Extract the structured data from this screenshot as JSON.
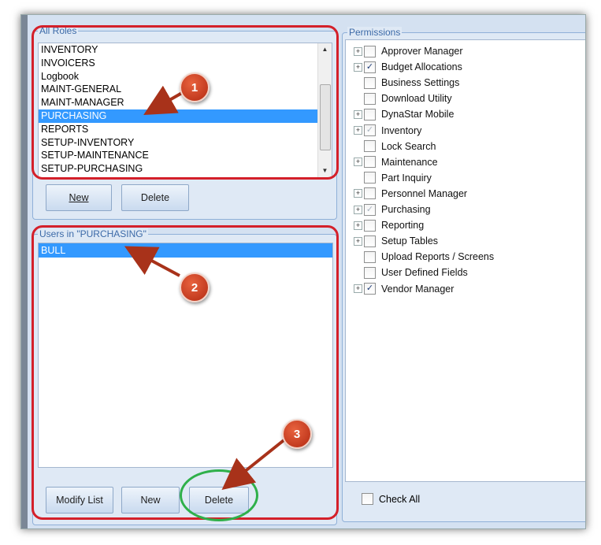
{
  "roles_panel": {
    "legend": "All Roles",
    "items": [
      "INVENTORY",
      "INVOICERS",
      "Logbook",
      "MAINT-GENERAL",
      "MAINT-MANAGER",
      "PURCHASING",
      "REPORTS",
      "SETUP-INVENTORY",
      "SETUP-MAINTENANCE",
      "SETUP-PURCHASING"
    ],
    "selected": "PURCHASING",
    "new_button": "New",
    "delete_button": "Delete"
  },
  "users_panel": {
    "legend": "Users in \"PURCHASING\"",
    "items": [
      "BULL"
    ],
    "modify_button": "Modify List",
    "new_button": "New",
    "delete_button": "Delete"
  },
  "permissions_panel": {
    "legend": "Permissions",
    "items": [
      {
        "label": "Approver Manager",
        "expandable": true,
        "state": "unchecked"
      },
      {
        "label": "Budget Allocations",
        "expandable": true,
        "state": "checked"
      },
      {
        "label": "Business Settings",
        "expandable": false,
        "state": "unchecked"
      },
      {
        "label": "Download Utility",
        "expandable": false,
        "state": "unchecked"
      },
      {
        "label": "DynaStar Mobile",
        "expandable": true,
        "state": "unchecked"
      },
      {
        "label": "Inventory",
        "expandable": true,
        "state": "partial"
      },
      {
        "label": "Lock Search",
        "expandable": false,
        "state": "unchecked"
      },
      {
        "label": "Maintenance",
        "expandable": true,
        "state": "unchecked"
      },
      {
        "label": "Part Inquiry",
        "expandable": false,
        "state": "unchecked"
      },
      {
        "label": "Personnel Manager",
        "expandable": true,
        "state": "unchecked"
      },
      {
        "label": "Purchasing",
        "expandable": true,
        "state": "partial"
      },
      {
        "label": "Reporting",
        "expandable": true,
        "state": "unchecked"
      },
      {
        "label": "Setup Tables",
        "expandable": true,
        "state": "unchecked"
      },
      {
        "label": "Upload Reports / Screens",
        "expandable": false,
        "state": "unchecked"
      },
      {
        "label": "User Defined Fields",
        "expandable": false,
        "state": "unchecked"
      },
      {
        "label": "Vendor Manager",
        "expandable": true,
        "state": "checked"
      }
    ],
    "check_all_label": "Check All"
  },
  "annotations": {
    "badge1": "1",
    "badge2": "2",
    "badge3": "3",
    "color": "#d4202a",
    "highlight_color": "#2fb04a"
  }
}
